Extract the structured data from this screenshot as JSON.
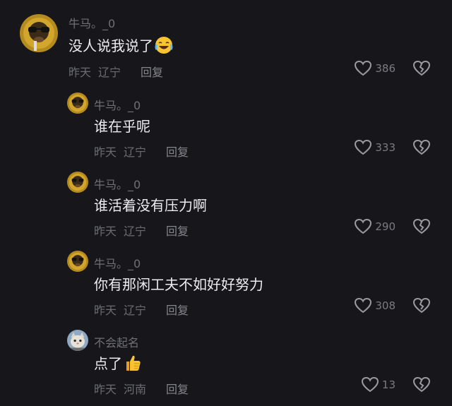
{
  "comments": [
    {
      "username": "牛马。_0",
      "text": "没人说我说了",
      "emoji": "laughing-crying-emoji",
      "time": "昨天",
      "location": "辽宁",
      "reply_label": "回复",
      "likes": "386"
    },
    {
      "username": "牛马。_0",
      "text": "谁在乎呢",
      "time": "昨天",
      "location": "辽宁",
      "reply_label": "回复",
      "likes": "333"
    },
    {
      "username": "牛马。_0",
      "text": "谁活着没有压力啊",
      "time": "昨天",
      "location": "辽宁",
      "reply_label": "回复",
      "likes": "290"
    },
    {
      "username": "牛马。_0",
      "text": "你有那闲工夫不如好好努力",
      "time": "昨天",
      "location": "辽宁",
      "reply_label": "回复",
      "likes": "308"
    },
    {
      "username": "不会起名",
      "text": "点了",
      "emoji": "thumbs-up-emoji",
      "time": "昨天",
      "location": "河南",
      "reply_label": "回复",
      "likes": "13"
    }
  ],
  "colors": {
    "background": "#17171b",
    "text": "#ececf0",
    "muted": "#6b6b74",
    "icon_stroke": "#9a9aa3"
  }
}
